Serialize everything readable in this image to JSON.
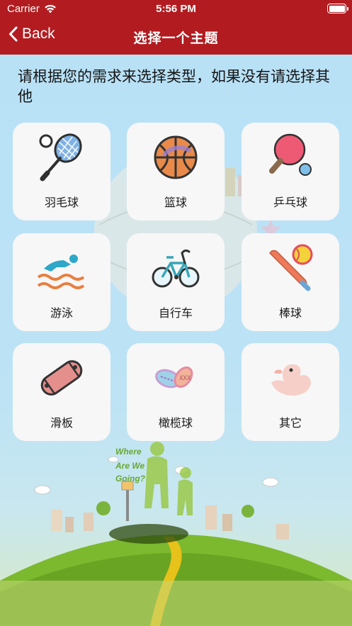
{
  "status_bar": {
    "carrier": "Carrier",
    "time": "5:56 PM"
  },
  "nav": {
    "back_label": "Back",
    "title": "选择一个主题"
  },
  "prompt": "请根据您的需求来选择类型，如果没有请选择其他",
  "topics": [
    {
      "label": "羽毛球",
      "icon": "badminton-racket-icon"
    },
    {
      "label": "篮球",
      "icon": "basketball-icon"
    },
    {
      "label": "乒乓球",
      "icon": "ping-pong-paddle-icon"
    },
    {
      "label": "游泳",
      "icon": "swimmer-icon"
    },
    {
      "label": "自行车",
      "icon": "bicycle-icon"
    },
    {
      "label": "棒球",
      "icon": "baseball-bat-icon"
    },
    {
      "label": "滑板",
      "icon": "skateboard-icon"
    },
    {
      "label": "橄榄球",
      "icon": "rugby-ball-icon"
    },
    {
      "label": "其它",
      "icon": "rubber-duck-icon"
    }
  ],
  "background_art": {
    "sign_lines": [
      "Where",
      "Are We",
      "Going?"
    ]
  },
  "colors": {
    "nav_bar": "#b21c20",
    "tile": "#f7f7f7",
    "sky": "#b8e1f6",
    "grass": "#7cb92e"
  }
}
